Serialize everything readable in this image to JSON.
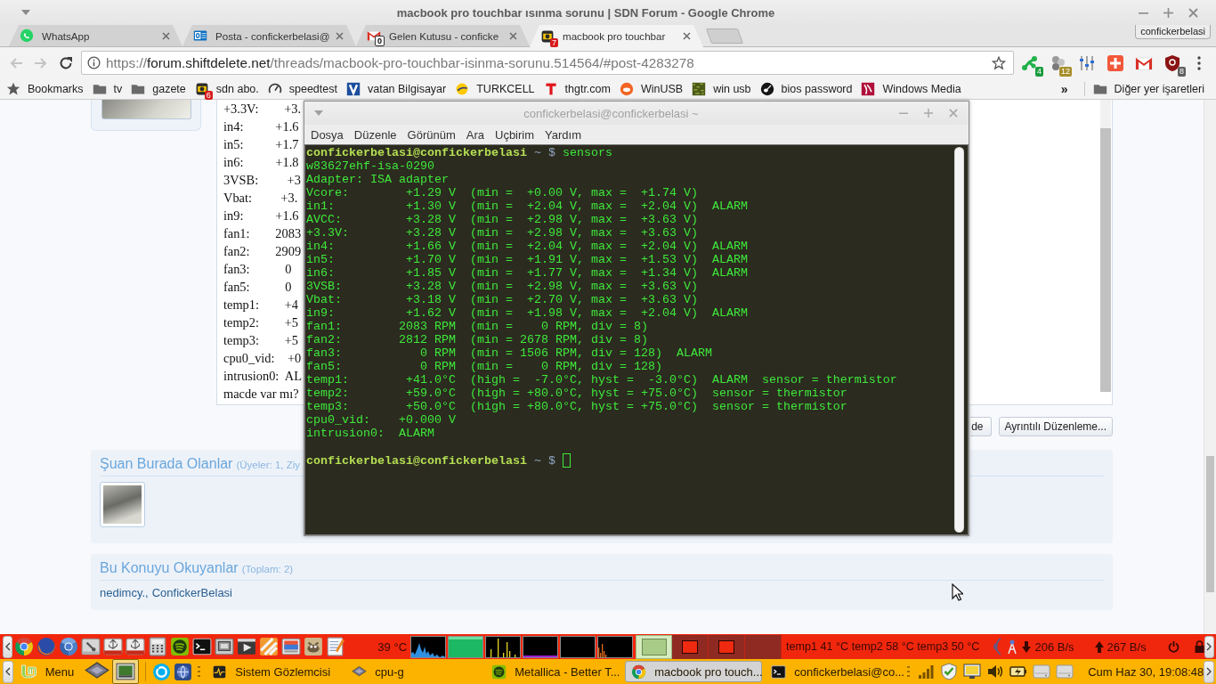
{
  "window": {
    "title": "macbook pro touchbar ısınma sorunu | SDN Forum - Google Chrome"
  },
  "tabs": [
    {
      "kind": "whatsapp",
      "label": "WhatsApp",
      "selected": false
    },
    {
      "kind": "outlook",
      "label": "Posta - confickerbelasi@",
      "selected": false
    },
    {
      "kind": "gmail",
      "label": "Gelen Kutusu - conficke",
      "badge": "0",
      "selected": false
    },
    {
      "kind": "forum",
      "label": "macbook pro touchbar",
      "badge": "7",
      "selected": true
    }
  ],
  "profile": {
    "label": "confickerbelasi"
  },
  "address_bar": {
    "scheme": "https://",
    "domain": "forum.shiftdelete.net",
    "path": "/threads/macbook-pro-touchbar-isinma-sorunu.514564/#post-4283278"
  },
  "extensions": [
    {
      "kind": "molecule",
      "badge": "4"
    },
    {
      "kind": "balls",
      "badge": "12"
    },
    {
      "kind": "sliders"
    },
    {
      "kind": "plus"
    },
    {
      "kind": "mail"
    },
    {
      "kind": "shield",
      "badge": "8"
    }
  ],
  "bookmarks": [
    {
      "kind": "star",
      "label": "Bookmarks"
    },
    {
      "kind": "folder",
      "label": "tv"
    },
    {
      "kind": "folder",
      "label": "gazete"
    },
    {
      "kind": "sdn",
      "label": "sdn abo.",
      "badge": "6"
    },
    {
      "kind": "gauge",
      "label": "speedtest"
    },
    {
      "kind": "vatan",
      "label": "vatan Bilgisayar"
    },
    {
      "kind": "turkcell",
      "label": "TURKCELL"
    },
    {
      "kind": "thgtr",
      "label": "thgtr.com"
    },
    {
      "kind": "ask",
      "label": "WinUSB"
    },
    {
      "kind": "texture",
      "label": "win usb"
    },
    {
      "kind": "guitar",
      "label": "bios password"
    },
    {
      "kind": "wm",
      "label": "Windows Media"
    }
  ],
  "bookmarks_overflow": "»",
  "other_bookmarks": {
    "label": "Diğer yer işaretleri"
  },
  "post": {
    "lines": [
      "+3.3V:        +3.",
      "in4:          +1.6",
      "in5:          +1.7",
      "in6:          +1.8",
      "3VSB:         +3",
      "Vbat:         +3.",
      "in9:          +1.6",
      "fan1:        2083",
      "fan2:        2909",
      "fan3:           0",
      "fan5:           0",
      "temp1:        +4",
      "temp2:        +5",
      "temp3:        +5",
      "cpu0_vid:    +0",
      "intrusion0:  AL",
      "macde var mı?"
    ],
    "buttons": [
      "de",
      "Ayrıntılı Düzenleme..."
    ]
  },
  "online_section": {
    "title": "Şuan Burada Olanlar",
    "count": "(Üyeler: 1, Ziy"
  },
  "readers_section": {
    "title": "Bu Konuyu Okuyanlar",
    "count": "(Toplam: 2)",
    "users": [
      {
        "name": "nedimcy.",
        "separator": ","
      },
      {
        "name": "ConfickerBelasi"
      }
    ]
  },
  "terminal_window": {
    "title": "confickerbelasi@confickerbelasi ~",
    "menu": [
      "Dosya",
      "Düzenle",
      "Görünüm",
      "Ara",
      "Uçbirim",
      "Yardım"
    ],
    "blocks": [
      {
        "prompt": {
          "user_host": "confickerbelasi@confickerbelasi",
          "path": "~",
          "symbol": "$",
          "command": "sensors"
        },
        "output": [
          "w83627ehf-isa-0290",
          "Adapter: ISA adapter",
          "Vcore:        +1.29 V  (min =  +0.00 V, max =  +1.74 V)",
          "in1:          +1.30 V  (min =  +2.04 V, max =  +2.04 V)  ALARM",
          "AVCC:         +3.28 V  (min =  +2.98 V, max =  +3.63 V)",
          "+3.3V:        +3.28 V  (min =  +2.98 V, max =  +3.63 V)",
          "in4:          +1.66 V  (min =  +2.04 V, max =  +2.04 V)  ALARM",
          "in5:          +1.70 V  (min =  +1.91 V, max =  +1.53 V)  ALARM",
          "in6:          +1.85 V  (min =  +1.77 V, max =  +1.34 V)  ALARM",
          "3VSB:         +3.28 V  (min =  +2.98 V, max =  +3.63 V)",
          "Vbat:         +3.18 V  (min =  +2.70 V, max =  +3.63 V)",
          "in9:          +1.62 V  (min =  +1.98 V, max =  +2.04 V)  ALARM",
          "fan1:        2083 RPM  (min =    0 RPM, div = 8)",
          "fan2:        2812 RPM  (min = 2678 RPM, div = 8)",
          "fan3:           0 RPM  (min = 1506 RPM, div = 128)  ALARM",
          "fan5:           0 RPM  (min =    0 RPM, div = 128)",
          "temp1:        +41.0°C  (high =  -7.0°C, hyst =  -3.0°C)  ALARM  sensor = thermistor",
          "temp2:        +59.0°C  (high = +80.0°C, hyst = +75.0°C)  sensor = thermistor",
          "temp3:        +50.0°C  (high = +80.0°C, hyst = +75.0°C)  sensor = thermistor",
          "cpu0_vid:    +0.000 V",
          "intrusion0:  ALARM"
        ]
      },
      {
        "prompt": {
          "user_host": "confickerbelasi@confickerbelasi",
          "path": "~",
          "symbol": "$",
          "cursor": true
        }
      }
    ]
  },
  "top_panel": {
    "launchers": [
      {
        "kind": "chrome"
      },
      {
        "kind": "firefox"
      },
      {
        "kind": "chromium"
      },
      {
        "kind": "toolbox"
      },
      {
        "kind": "usb"
      },
      {
        "kind": "usb"
      },
      {
        "kind": "calculator"
      },
      {
        "kind": "spotify"
      },
      {
        "kind": "terminal"
      },
      {
        "kind": "screenshot"
      },
      {
        "kind": "player"
      },
      {
        "kind": "clapper"
      },
      {
        "kind": "viewer"
      },
      {
        "kind": "gimp"
      },
      {
        "kind": "notepad"
      }
    ],
    "cpu_temp": "39 °C",
    "graphs": [
      {
        "kind": "cpu"
      },
      {
        "kind": "memory"
      },
      {
        "kind": "network"
      },
      {
        "kind": "swap"
      },
      {
        "kind": "load"
      },
      {
        "kind": "disk"
      }
    ],
    "workspaces": [
      {
        "selected": true,
        "has_window": true
      },
      {
        "selected": false,
        "has_window": true
      },
      {
        "selected": false,
        "has_window": true
      },
      {
        "selected": false,
        "has_window": false
      }
    ],
    "sensors_text": "temp1 41 °C temp2 58 °C temp3 50 °C",
    "net_down": "206 B/s",
    "net_up": "267 B/s"
  },
  "bottom_panel": {
    "menu_label": "Menu",
    "launchers": [
      {
        "kind": "chip"
      },
      {
        "kind": "monitor"
      },
      {
        "kind": "skype"
      },
      {
        "kind": "globe"
      }
    ],
    "tasks": [
      {
        "kind": "sysmon",
        "label": "Sistem Gözlemcisi",
        "selected": false
      },
      {
        "kind": "chip",
        "label": "cpu-g",
        "selected": false
      },
      {
        "kind": "spotify",
        "label": "Metallica - Better T...",
        "selected": false
      },
      {
        "kind": "chrome",
        "label": "macbook pro touch...",
        "selected": true
      },
      {
        "kind": "terminal",
        "label": "confickerbelasi@co...",
        "selected": false
      }
    ],
    "tray": [
      {
        "kind": "signal"
      },
      {
        "kind": "security"
      },
      {
        "kind": "display"
      },
      {
        "kind": "volume"
      },
      {
        "kind": "battery"
      },
      {
        "kind": "drive"
      },
      {
        "kind": "drive"
      }
    ],
    "clock": "Cum Haz 30, 19:08:48"
  }
}
